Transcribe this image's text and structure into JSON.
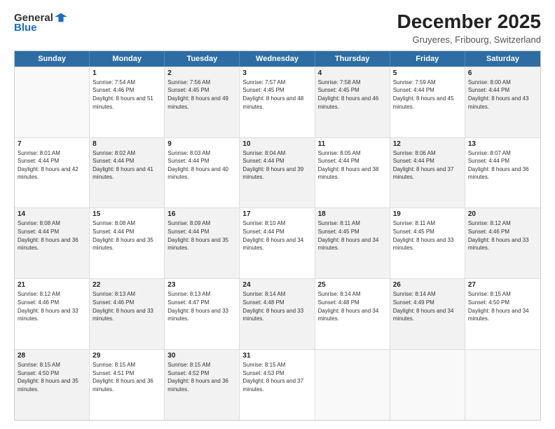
{
  "header": {
    "logo_general": "General",
    "logo_blue": "Blue",
    "title": "December 2025",
    "subtitle": "Gruyeres, Fribourg, Switzerland"
  },
  "days": [
    "Sunday",
    "Monday",
    "Tuesday",
    "Wednesday",
    "Thursday",
    "Friday",
    "Saturday"
  ],
  "weeks": [
    [
      {
        "day": "",
        "sunrise": "",
        "sunset": "",
        "daylight": "",
        "shaded": false,
        "empty": true
      },
      {
        "day": "1",
        "sunrise": "Sunrise: 7:54 AM",
        "sunset": "Sunset: 4:46 PM",
        "daylight": "Daylight: 8 hours and 51 minutes.",
        "shaded": false
      },
      {
        "day": "2",
        "sunrise": "Sunrise: 7:56 AM",
        "sunset": "Sunset: 4:45 PM",
        "daylight": "Daylight: 8 hours and 49 minutes.",
        "shaded": true
      },
      {
        "day": "3",
        "sunrise": "Sunrise: 7:57 AM",
        "sunset": "Sunset: 4:45 PM",
        "daylight": "Daylight: 8 hours and 48 minutes.",
        "shaded": false
      },
      {
        "day": "4",
        "sunrise": "Sunrise: 7:58 AM",
        "sunset": "Sunset: 4:45 PM",
        "daylight": "Daylight: 8 hours and 46 minutes.",
        "shaded": true
      },
      {
        "day": "5",
        "sunrise": "Sunrise: 7:59 AM",
        "sunset": "Sunset: 4:44 PM",
        "daylight": "Daylight: 8 hours and 45 minutes.",
        "shaded": false
      },
      {
        "day": "6",
        "sunrise": "Sunrise: 8:00 AM",
        "sunset": "Sunset: 4:44 PM",
        "daylight": "Daylight: 8 hours and 43 minutes.",
        "shaded": true
      }
    ],
    [
      {
        "day": "7",
        "sunrise": "Sunrise: 8:01 AM",
        "sunset": "Sunset: 4:44 PM",
        "daylight": "Daylight: 8 hours and 42 minutes.",
        "shaded": false
      },
      {
        "day": "8",
        "sunrise": "Sunrise: 8:02 AM",
        "sunset": "Sunset: 4:44 PM",
        "daylight": "Daylight: 8 hours and 41 minutes.",
        "shaded": true
      },
      {
        "day": "9",
        "sunrise": "Sunrise: 8:03 AM",
        "sunset": "Sunset: 4:44 PM",
        "daylight": "Daylight: 8 hours and 40 minutes.",
        "shaded": false
      },
      {
        "day": "10",
        "sunrise": "Sunrise: 8:04 AM",
        "sunset": "Sunset: 4:44 PM",
        "daylight": "Daylight: 8 hours and 39 minutes.",
        "shaded": true
      },
      {
        "day": "11",
        "sunrise": "Sunrise: 8:05 AM",
        "sunset": "Sunset: 4:44 PM",
        "daylight": "Daylight: 8 hours and 38 minutes.",
        "shaded": false
      },
      {
        "day": "12",
        "sunrise": "Sunrise: 8:06 AM",
        "sunset": "Sunset: 4:44 PM",
        "daylight": "Daylight: 8 hours and 37 minutes.",
        "shaded": true
      },
      {
        "day": "13",
        "sunrise": "Sunrise: 8:07 AM",
        "sunset": "Sunset: 4:44 PM",
        "daylight": "Daylight: 8 hours and 36 minutes.",
        "shaded": false
      }
    ],
    [
      {
        "day": "14",
        "sunrise": "Sunrise: 8:08 AM",
        "sunset": "Sunset: 4:44 PM",
        "daylight": "Daylight: 8 hours and 36 minutes.",
        "shaded": true
      },
      {
        "day": "15",
        "sunrise": "Sunrise: 8:08 AM",
        "sunset": "Sunset: 4:44 PM",
        "daylight": "Daylight: 8 hours and 35 minutes.",
        "shaded": false
      },
      {
        "day": "16",
        "sunrise": "Sunrise: 8:09 AM",
        "sunset": "Sunset: 4:44 PM",
        "daylight": "Daylight: 8 hours and 35 minutes.",
        "shaded": true
      },
      {
        "day": "17",
        "sunrise": "Sunrise: 8:10 AM",
        "sunset": "Sunset: 4:44 PM",
        "daylight": "Daylight: 8 hours and 34 minutes.",
        "shaded": false
      },
      {
        "day": "18",
        "sunrise": "Sunrise: 8:11 AM",
        "sunset": "Sunset: 4:45 PM",
        "daylight": "Daylight: 8 hours and 34 minutes.",
        "shaded": true
      },
      {
        "day": "19",
        "sunrise": "Sunrise: 8:11 AM",
        "sunset": "Sunset: 4:45 PM",
        "daylight": "Daylight: 8 hours and 33 minutes.",
        "shaded": false
      },
      {
        "day": "20",
        "sunrise": "Sunrise: 8:12 AM",
        "sunset": "Sunset: 4:46 PM",
        "daylight": "Daylight: 8 hours and 33 minutes.",
        "shaded": true
      }
    ],
    [
      {
        "day": "21",
        "sunrise": "Sunrise: 8:12 AM",
        "sunset": "Sunset: 4:46 PM",
        "daylight": "Daylight: 8 hours and 33 minutes.",
        "shaded": false
      },
      {
        "day": "22",
        "sunrise": "Sunrise: 8:13 AM",
        "sunset": "Sunset: 4:46 PM",
        "daylight": "Daylight: 8 hours and 33 minutes.",
        "shaded": true
      },
      {
        "day": "23",
        "sunrise": "Sunrise: 8:13 AM",
        "sunset": "Sunset: 4:47 PM",
        "daylight": "Daylight: 8 hours and 33 minutes.",
        "shaded": false
      },
      {
        "day": "24",
        "sunrise": "Sunrise: 8:14 AM",
        "sunset": "Sunset: 4:48 PM",
        "daylight": "Daylight: 8 hours and 33 minutes.",
        "shaded": true
      },
      {
        "day": "25",
        "sunrise": "Sunrise: 8:14 AM",
        "sunset": "Sunset: 4:48 PM",
        "daylight": "Daylight: 8 hours and 34 minutes.",
        "shaded": false
      },
      {
        "day": "26",
        "sunrise": "Sunrise: 8:14 AM",
        "sunset": "Sunset: 4:49 PM",
        "daylight": "Daylight: 8 hours and 34 minutes.",
        "shaded": true
      },
      {
        "day": "27",
        "sunrise": "Sunrise: 8:15 AM",
        "sunset": "Sunset: 4:50 PM",
        "daylight": "Daylight: 8 hours and 34 minutes.",
        "shaded": false
      }
    ],
    [
      {
        "day": "28",
        "sunrise": "Sunrise: 8:15 AM",
        "sunset": "Sunset: 4:50 PM",
        "daylight": "Daylight: 8 hours and 35 minutes.",
        "shaded": true
      },
      {
        "day": "29",
        "sunrise": "Sunrise: 8:15 AM",
        "sunset": "Sunset: 4:51 PM",
        "daylight": "Daylight: 8 hours and 36 minutes.",
        "shaded": false
      },
      {
        "day": "30",
        "sunrise": "Sunrise: 8:15 AM",
        "sunset": "Sunset: 4:52 PM",
        "daylight": "Daylight: 8 hours and 36 minutes.",
        "shaded": true
      },
      {
        "day": "31",
        "sunrise": "Sunrise: 8:15 AM",
        "sunset": "Sunset: 4:53 PM",
        "daylight": "Daylight: 8 hours and 37 minutes.",
        "shaded": false
      },
      {
        "day": "",
        "sunrise": "",
        "sunset": "",
        "daylight": "",
        "shaded": false,
        "empty": true
      },
      {
        "day": "",
        "sunrise": "",
        "sunset": "",
        "daylight": "",
        "shaded": false,
        "empty": true
      },
      {
        "day": "",
        "sunrise": "",
        "sunset": "",
        "daylight": "",
        "shaded": false,
        "empty": true
      }
    ]
  ]
}
